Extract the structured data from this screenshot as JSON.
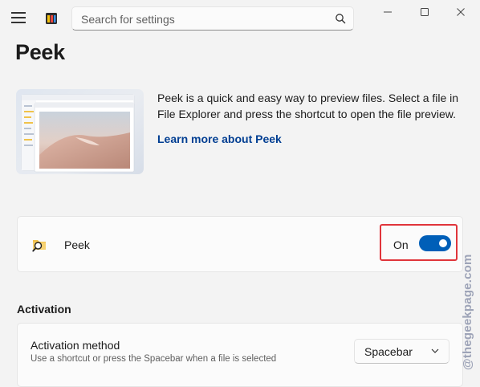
{
  "search": {
    "placeholder": "Search for settings"
  },
  "icons": {
    "menu": "hamburger-menu-icon",
    "app": "powertoys-logo-icon",
    "search": "search-icon",
    "minimize": "minimize-icon",
    "maximize": "maximize-icon",
    "close": "close-icon",
    "peek": "peek-magnifier-folder-icon",
    "dropdown": "chevron-down-icon"
  },
  "page": {
    "title": "Peek",
    "description": "Peek is a quick and easy way to preview files. Select a file in File Explorer and press the shortcut to open the file preview.",
    "learn_more": "Learn more about Peek"
  },
  "peek_card": {
    "label": "Peek",
    "toggle_state": "On",
    "toggle_on": true
  },
  "activation": {
    "section_title": "Activation",
    "method_title": "Activation method",
    "method_description": "Use a shortcut or press the Spacebar when a file is selected",
    "selected": "Spacebar"
  },
  "watermark": "@thegeekpage.com",
  "colors": {
    "accent": "#005fb8",
    "link": "#003e92",
    "highlight": "#e0353b",
    "background": "#f3f3f3"
  }
}
